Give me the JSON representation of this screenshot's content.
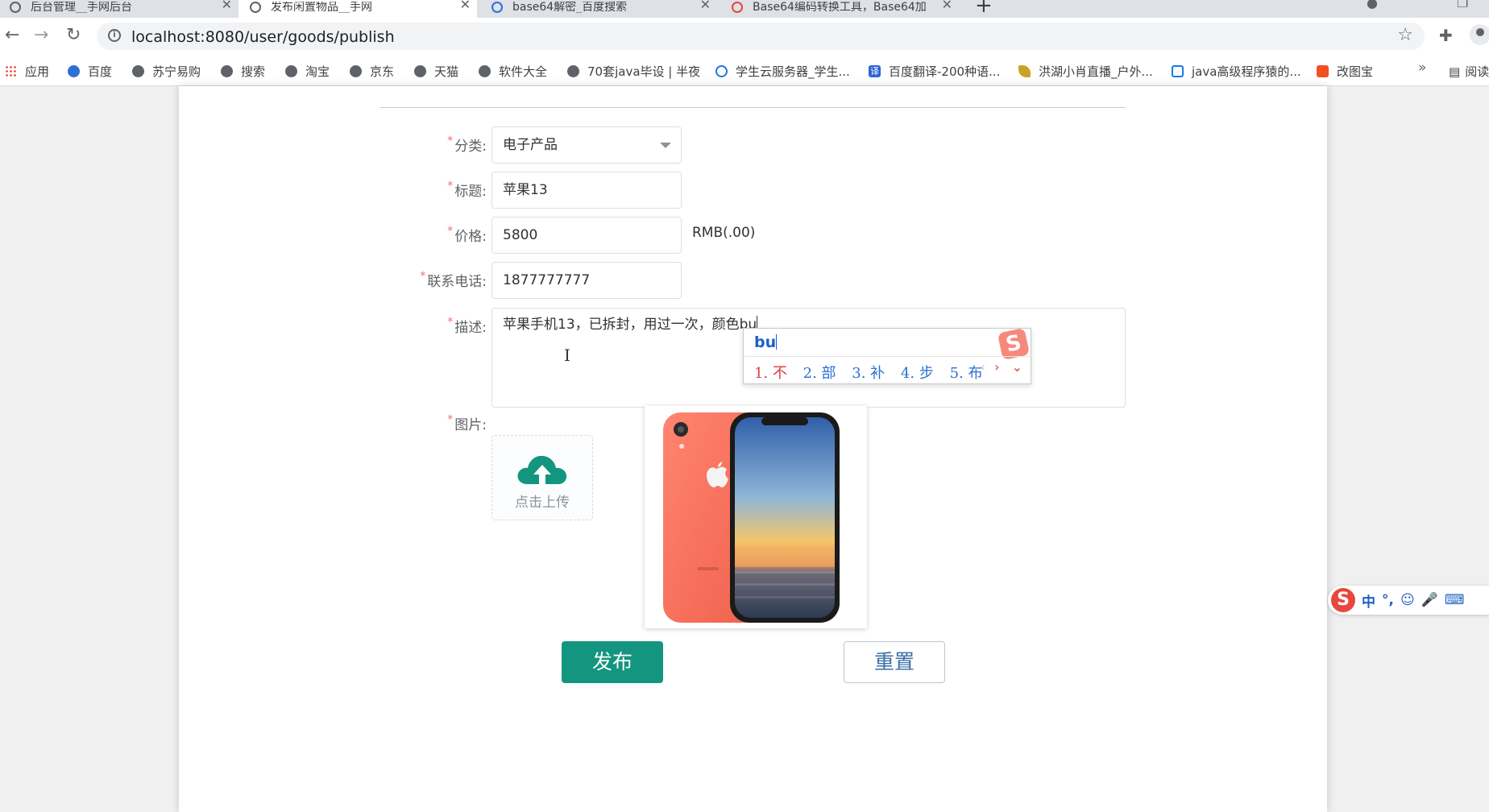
{
  "browser": {
    "tabs": [
      {
        "title": "后台管理__手网后台",
        "active": false
      },
      {
        "title": "发布闲置物品__手网",
        "active": true
      },
      {
        "title": "base64解密_百度搜索",
        "active": false
      },
      {
        "title": "Base64编码转换工具，Base64加",
        "active": false
      }
    ],
    "new_tab": "+",
    "url": "localhost:8080/user/goods/publish",
    "bookmarks": [
      {
        "label": "应用",
        "icon": "apps-grid-icon"
      },
      {
        "label": "百度",
        "icon": "baidu-paw-icon"
      },
      {
        "label": "苏宁易购",
        "icon": "globe-icon"
      },
      {
        "label": "搜索",
        "icon": "globe-icon"
      },
      {
        "label": "淘宝",
        "icon": "globe-icon"
      },
      {
        "label": "京东",
        "icon": "globe-icon"
      },
      {
        "label": "天猫",
        "icon": "globe-icon"
      },
      {
        "label": "软件大全",
        "icon": "globe-icon"
      },
      {
        "label": "70套java毕设 | 半夜",
        "icon": "globe-icon"
      },
      {
        "label": "学生云服务器_学生...",
        "icon": "cloud-icon"
      },
      {
        "label": "百度翻译-200种语...",
        "icon": "translate-icon"
      },
      {
        "label": "洪湖小肖直播_户外...",
        "icon": "feather-icon"
      },
      {
        "label": "java高级程序猿的...",
        "icon": "bilibili-tv-icon"
      },
      {
        "label": "改图宝",
        "icon": "orange-square-icon"
      }
    ],
    "more": "»",
    "reading_list": "阅读"
  },
  "form": {
    "category": {
      "label": "分类:",
      "value": "电子产品"
    },
    "title": {
      "label": "标题:",
      "value": "苹果13"
    },
    "price": {
      "label": "价格:",
      "value": "5800",
      "unit": "RMB(.00)"
    },
    "phone": {
      "label": "联系电话:",
      "value": "1877777777"
    },
    "description": {
      "label": "描述:",
      "value": "苹果手机13，已拆封，用过一次，颜色bu"
    },
    "image": {
      "label": "图片:",
      "upload_text": "点击上传"
    },
    "required_mark": "*",
    "publish_button": "发布",
    "reset_button": "重置"
  },
  "ime": {
    "pinyin": "bu",
    "candidates": [
      "1. 不",
      "2. 部",
      "3. 补",
      "4. 步",
      "5. 布"
    ],
    "toolbar_items": [
      "中",
      "°,",
      "☺",
      "🎤",
      "⌨"
    ]
  },
  "colors": {
    "primary": "#14957f",
    "required": "#f56c6c",
    "ime_blue": "#2b6fd0",
    "ime_red": "#e03a3a"
  }
}
